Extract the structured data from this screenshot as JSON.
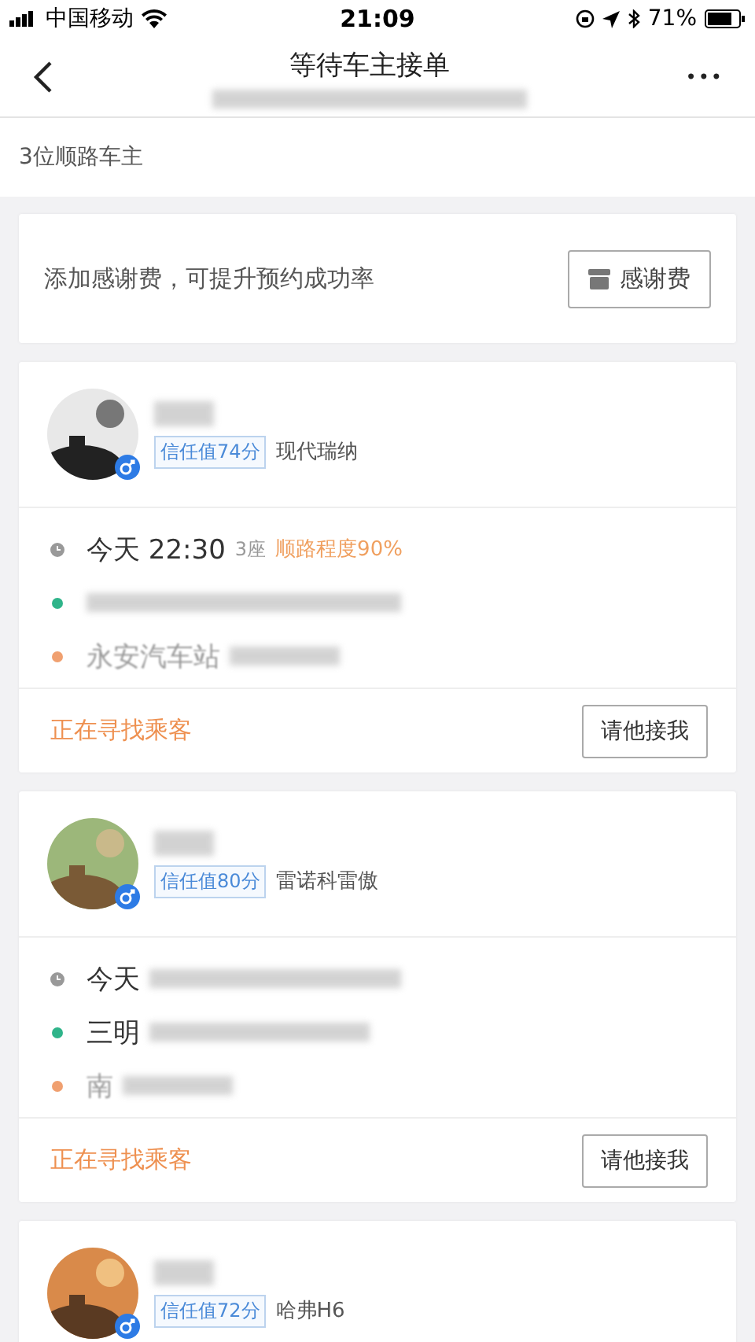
{
  "status_bar": {
    "carrier": "中国移动",
    "time": "21:09",
    "battery": "71%"
  },
  "nav": {
    "title": "等待车主接单",
    "more": "•••"
  },
  "count": "3位顺路车主",
  "thanks": {
    "text": "添加感谢费，可提升预约成功率",
    "button": "感谢费"
  },
  "drivers": [
    {
      "trust": "信任值74分",
      "car": "现代瑞纳",
      "time": "今天 22:30",
      "seats": "3座",
      "match": "顺路程度90%",
      "end": "永安汽车站",
      "status": "正在寻找乘客",
      "button": "请他接我"
    },
    {
      "trust": "信任值80分",
      "car": "雷诺科雷傲",
      "time": "今天",
      "start": "三明",
      "end": "南",
      "status": "正在寻找乘客",
      "button": "请他接我"
    },
    {
      "trust": "信任值72分",
      "car": "哈弗H6"
    }
  ]
}
